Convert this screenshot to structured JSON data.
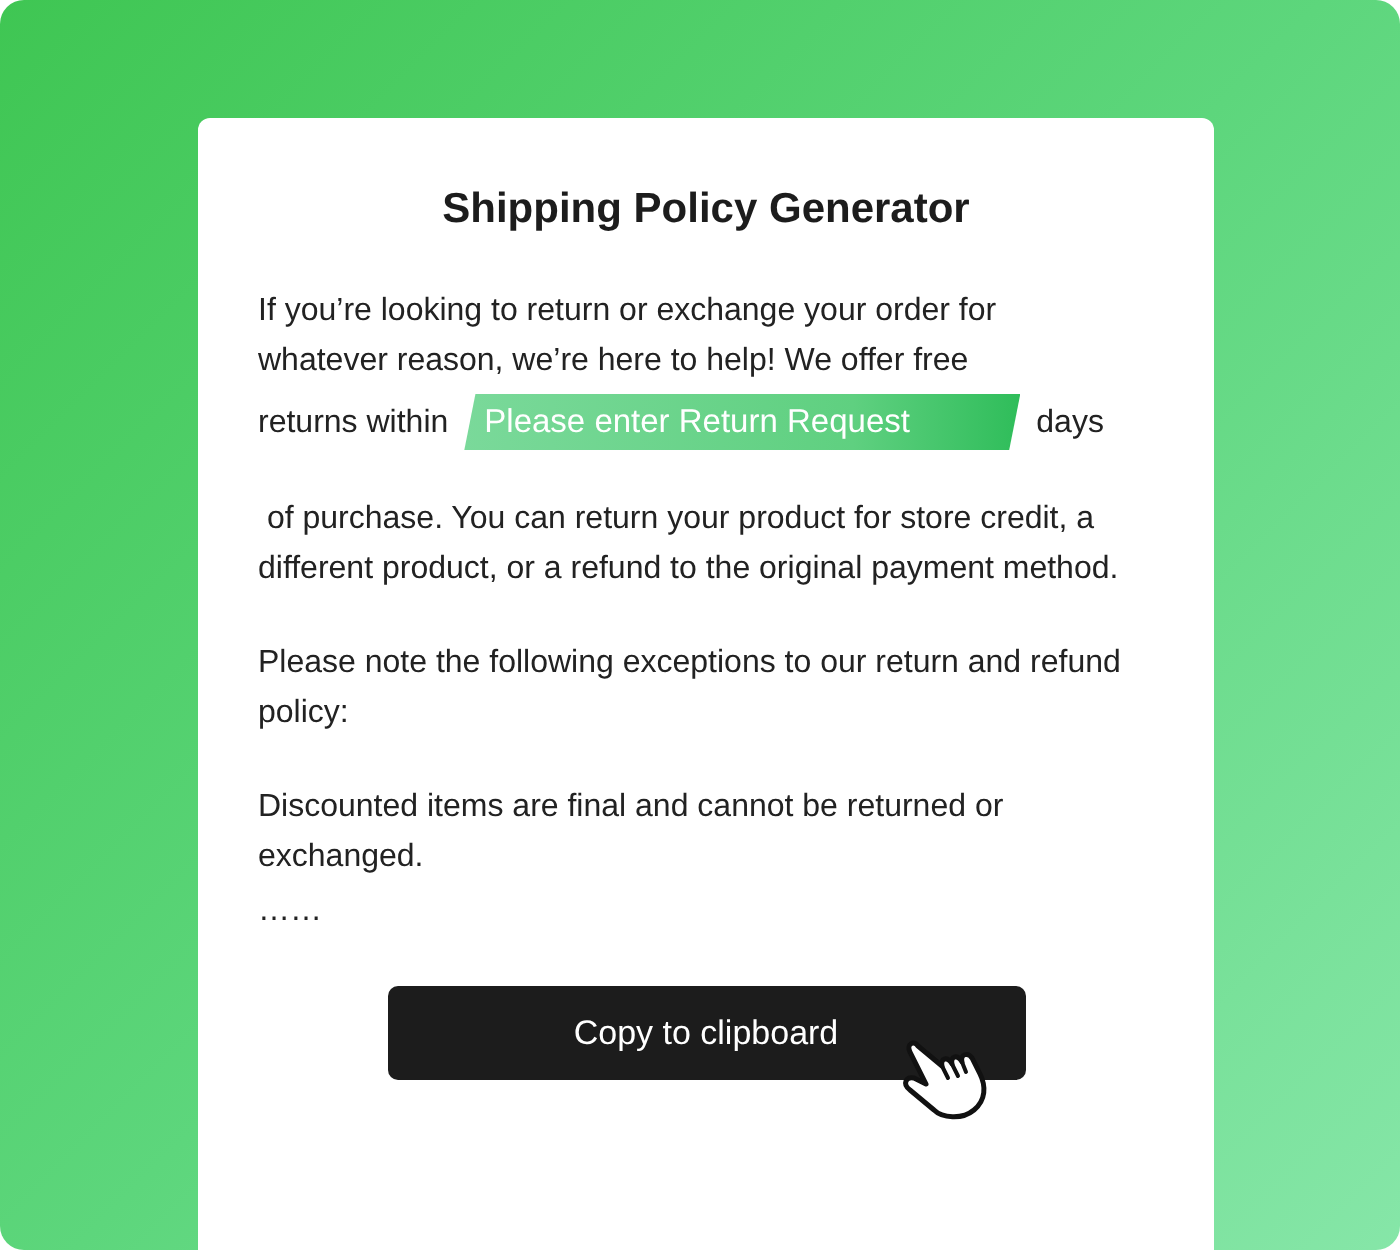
{
  "title": "Shipping Policy Generator",
  "intro": {
    "before": "If you’re looking to return or exchange your order for whatever reason, we’re here to help! We offer free",
    "lead": "returns within",
    "field": {
      "placeholder": "Please enter Return Request"
    },
    "after": "days"
  },
  "paragraphs": [
    " of purchase. You can return your product for store credit, a different product, or a refund to the original payment method.",
    "Please note the following exceptions to our return and refund policy:",
    "Discounted items are final and cannot be returned or exchanged."
  ],
  "ellipsis": "……",
  "button": {
    "label": "Copy to clipboard"
  }
}
